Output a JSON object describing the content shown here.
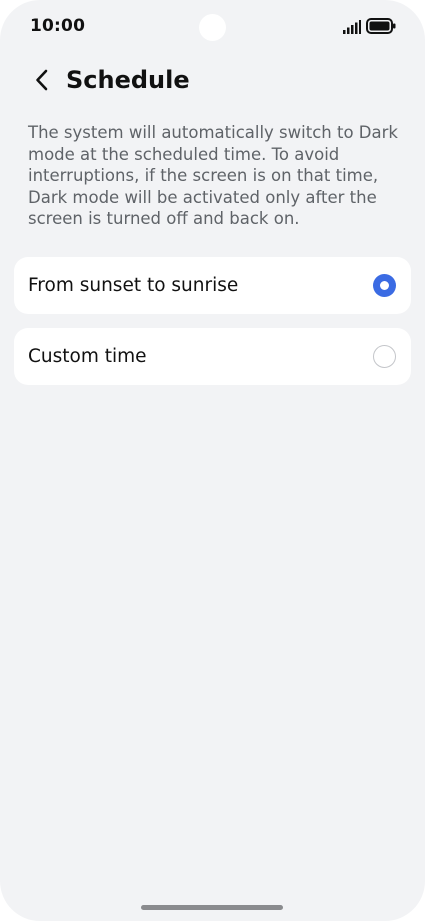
{
  "status_bar": {
    "time": "10:00",
    "icons": [
      "signal-icon",
      "battery-icon"
    ]
  },
  "header": {
    "back_icon": "chevron-left-icon",
    "title": "Schedule"
  },
  "description": "The system will automatically switch to Dark mode at the scheduled time. To avoid interruptions, if the screen is on that time, Dark mode will be activated only after the screen is turned off and back on.",
  "options": [
    {
      "label": "From sunset to sunrise",
      "selected": true
    },
    {
      "label": "Custom time",
      "selected": false
    }
  ],
  "colors": {
    "background": "#f2f3f5",
    "card": "#ffffff",
    "accent": "#3b6be3",
    "text_primary": "#111111",
    "text_secondary": "#5f6368"
  }
}
